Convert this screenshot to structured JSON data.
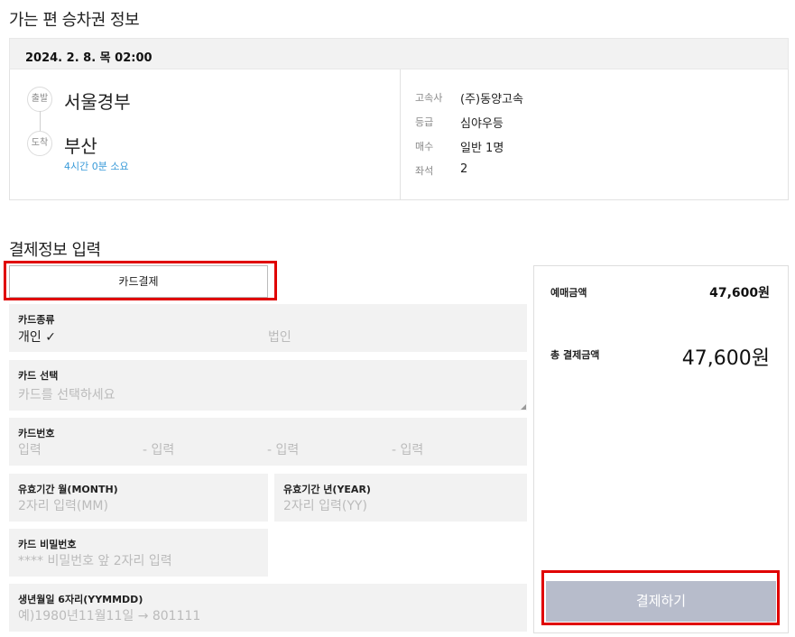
{
  "ticket": {
    "section_title": "가는 편 승차권 정보",
    "date": "2024. 2. 8. 목 02:00",
    "departure_badge": "출발",
    "departure": "서울경부",
    "arrival_badge": "도착",
    "arrival": "부산",
    "duration": "4시간 0분 소요",
    "details": [
      {
        "label": "고속사",
        "value": "(주)동양고속"
      },
      {
        "label": "등급",
        "value": "심야우등"
      },
      {
        "label": "매수",
        "value": "일반 1명"
      },
      {
        "label": "좌석",
        "value": "2"
      }
    ]
  },
  "payment": {
    "section_title": "결제정보 입력",
    "method_label": "카드결제",
    "card_type": {
      "label": "카드종류",
      "personal": "개인",
      "checkmark": "✓",
      "corporate": "법인"
    },
    "card_select": {
      "label": "카드 선택",
      "placeholder": "카드를 선택하세요"
    },
    "card_number": {
      "label": "카드번호",
      "placeholders": [
        "입력",
        "- 입력",
        "- 입력",
        "- 입력"
      ]
    },
    "expiry_month": {
      "label": "유효기간 월(MONTH)",
      "placeholder": "2자리 입력(MM)"
    },
    "expiry_year": {
      "label": "유효기간 년(YEAR)",
      "placeholder": "2자리 입력(YY)"
    },
    "card_password": {
      "label": "카드 비밀번호",
      "placeholder": "**** 비밀번호 앞 2자리 입력"
    },
    "birthdate": {
      "label": "생년월일 6자리(YYMMDD)",
      "placeholder": "예)1980년11월11일 → 801111"
    }
  },
  "summary": {
    "fare_label": "예매금액",
    "fare_value": "47,600원",
    "total_label": "총 결제금액",
    "total_value": "47,600원",
    "pay_button": "결제하기"
  },
  "colors": {
    "highlight": "#e00000",
    "pay_button_bg": "#b7bccb",
    "duration_text": "#3a9bd9",
    "field_bg": "#f2f2f2"
  }
}
